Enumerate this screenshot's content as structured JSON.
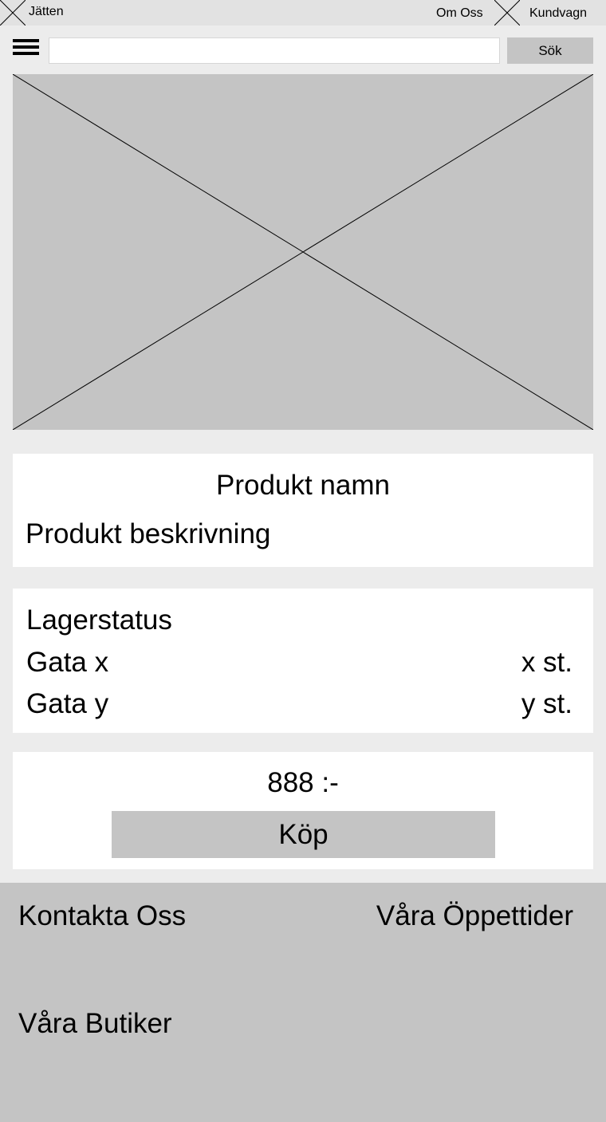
{
  "header": {
    "brand": "Jätten",
    "about_link": "Om Oss",
    "cart_link": "Kundvagn",
    "logo_icon": "image-placeholder-icon",
    "cart_icon": "image-placeholder-icon"
  },
  "search": {
    "value": "",
    "button_label": "Sök",
    "menu_icon": "hamburger-menu-icon"
  },
  "product": {
    "image": "image-placeholder",
    "name": "Produkt namn",
    "description": "Produkt beskrivning"
  },
  "stock": {
    "title": "Lagerstatus",
    "rows": [
      {
        "store": "Gata x",
        "quantity": "x st."
      },
      {
        "store": "Gata y",
        "quantity": "y st."
      }
    ]
  },
  "purchase": {
    "price": "888 :-",
    "buy_label": "Köp"
  },
  "footer": {
    "contact": "Kontakta Oss",
    "hours": "Våra Öppettider",
    "stores": "Våra Butiker"
  },
  "colors": {
    "background": "#ececec",
    "topbar": "#e2e2e2",
    "placeholder": "#c4c4c4",
    "panel": "#ffffff"
  }
}
